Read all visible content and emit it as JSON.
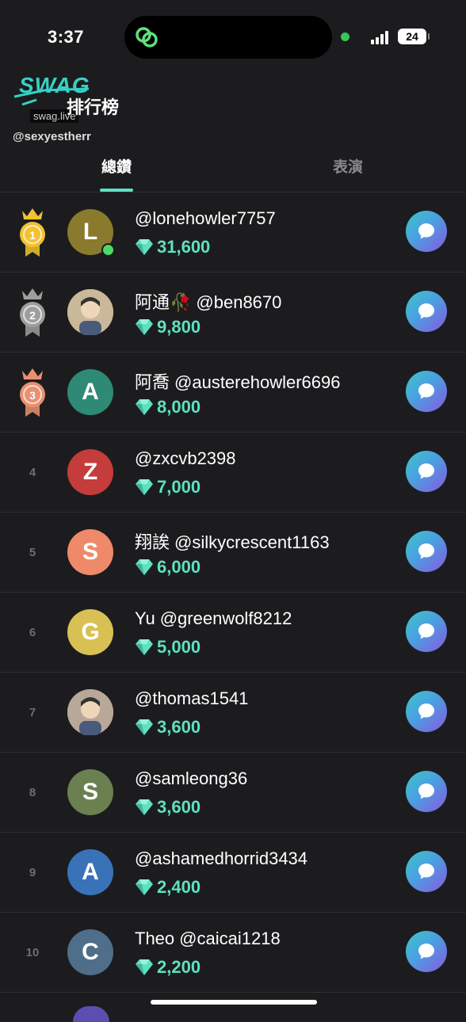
{
  "status_bar": {
    "time": "3:37",
    "battery": "24"
  },
  "header": {
    "logo_text": "SWAG",
    "logo_url": "swag.live",
    "title": "排行榜",
    "watermark_user": "@sexyestherr"
  },
  "tabs": [
    {
      "label": "總鑽",
      "active": true
    },
    {
      "label": "表演",
      "active": false
    }
  ],
  "colors": {
    "accent": "#5ee0c3",
    "gold": "#f2c230",
    "silver": "#9e9e9e",
    "bronze": "#e89070"
  },
  "rows": [
    {
      "rank": "1",
      "medal": "gold",
      "avatar_letter": "L",
      "avatar_color": "#8a7a2e",
      "nick": "",
      "handle": "@lonehowler7757",
      "amount": "31,600",
      "online": true
    },
    {
      "rank": "2",
      "medal": "silver",
      "avatar_letter": "",
      "avatar_color": "#c9b89a",
      "nick": "阿通🥀",
      "handle": "@ben8670",
      "amount": "9,800",
      "online": false
    },
    {
      "rank": "3",
      "medal": "bronze",
      "avatar_letter": "A",
      "avatar_color": "#2e8a74",
      "nick": "阿喬",
      "handle": "@austerehowler6696",
      "amount": "8,000",
      "online": false
    },
    {
      "rank": "4",
      "medal": "",
      "avatar_letter": "Z",
      "avatar_color": "#c43c3c",
      "nick": "",
      "handle": "@zxcvb2398",
      "amount": "7,000",
      "online": false
    },
    {
      "rank": "5",
      "medal": "",
      "avatar_letter": "S",
      "avatar_color": "#ee8a6a",
      "nick": "翔誒",
      "handle": "@silkycrescent1163",
      "amount": "6,000",
      "online": false
    },
    {
      "rank": "6",
      "medal": "",
      "avatar_letter": "G",
      "avatar_color": "#d9c054",
      "nick": "Yu",
      "handle": "@greenwolf8212",
      "amount": "5,000",
      "online": false
    },
    {
      "rank": "7",
      "medal": "",
      "avatar_letter": "",
      "avatar_color": "#b8a89a",
      "nick": "",
      "handle": "@thomas1541",
      "amount": "3,600",
      "online": false
    },
    {
      "rank": "8",
      "medal": "",
      "avatar_letter": "S",
      "avatar_color": "#6a8050",
      "nick": "",
      "handle": "@samleong36",
      "amount": "3,600",
      "online": false
    },
    {
      "rank": "9",
      "medal": "",
      "avatar_letter": "A",
      "avatar_color": "#3a72b8",
      "nick": "",
      "handle": "@ashamedhorrid3434",
      "amount": "2,400",
      "online": false
    },
    {
      "rank": "10",
      "medal": "",
      "avatar_letter": "C",
      "avatar_color": "#4e6e8a",
      "nick": "Theo",
      "handle": "@caicai1218",
      "amount": "2,200",
      "online": false
    }
  ]
}
